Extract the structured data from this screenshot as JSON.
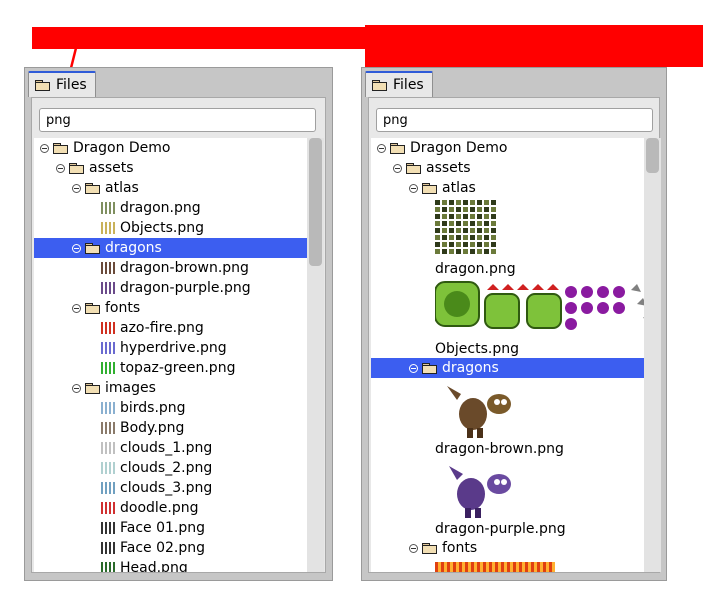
{
  "colors": {
    "accent": "#ff0000",
    "selection": "#3c5ef0"
  },
  "left_panel": {
    "tab_label": "Files",
    "search_value": "png",
    "tree": [
      {
        "label": "Dragon Demo",
        "kind": "folder",
        "icon": "folder-icon"
      },
      {
        "label": "assets",
        "kind": "folder",
        "icon": "folder-icon"
      },
      {
        "label": "atlas",
        "kind": "folder",
        "icon": "folder-icon"
      },
      {
        "label": "dragon.png",
        "kind": "file",
        "icon": "image-thumb-icon"
      },
      {
        "label": "Objects.png",
        "kind": "file",
        "icon": "image-thumb-icon"
      },
      {
        "label": "dragons",
        "kind": "folder",
        "icon": "folder-icon",
        "selected": true
      },
      {
        "label": "dragon-brown.png",
        "kind": "file",
        "icon": "image-thumb-icon"
      },
      {
        "label": "dragon-purple.png",
        "kind": "file",
        "icon": "image-thumb-icon"
      },
      {
        "label": "fonts",
        "kind": "folder",
        "icon": "folder-icon"
      },
      {
        "label": "azo-fire.png",
        "kind": "file",
        "icon": "image-thumb-icon"
      },
      {
        "label": "hyperdrive.png",
        "kind": "file",
        "icon": "image-thumb-icon"
      },
      {
        "label": "topaz-green.png",
        "kind": "file",
        "icon": "image-thumb-icon"
      },
      {
        "label": "images",
        "kind": "folder",
        "icon": "folder-icon"
      },
      {
        "label": "birds.png",
        "kind": "file",
        "icon": "image-thumb-icon"
      },
      {
        "label": "Body.png",
        "kind": "file",
        "icon": "image-thumb-icon"
      },
      {
        "label": "clouds_1.png",
        "kind": "file",
        "icon": "image-thumb-icon"
      },
      {
        "label": "clouds_2.png",
        "kind": "file",
        "icon": "image-thumb-icon"
      },
      {
        "label": "clouds_3.png",
        "kind": "file",
        "icon": "image-thumb-icon"
      },
      {
        "label": "doodle.png",
        "kind": "file",
        "icon": "image-thumb-icon"
      },
      {
        "label": "Face 01.png",
        "kind": "file",
        "icon": "image-thumb-icon"
      },
      {
        "label": "Face 02.png",
        "kind": "file",
        "icon": "image-thumb-icon"
      },
      {
        "label": "Head.png",
        "kind": "file",
        "icon": "image-thumb-icon"
      }
    ]
  },
  "right_panel": {
    "tab_label": "Files",
    "search_value": "png",
    "tree": [
      {
        "label": "Dragon Demo",
        "kind": "folder"
      },
      {
        "label": "assets",
        "kind": "folder"
      },
      {
        "label": "atlas",
        "kind": "folder"
      },
      {
        "label": "dragon.png",
        "kind": "image",
        "icon": "dragon-atlas-preview"
      },
      {
        "label": "Objects.png",
        "kind": "image",
        "icon": "objects-preview"
      },
      {
        "label": "dragons",
        "kind": "folder",
        "selected": true
      },
      {
        "label": "dragon-brown.png",
        "kind": "image",
        "icon": "brown-dragon-preview"
      },
      {
        "label": "dragon-purple.png",
        "kind": "image",
        "icon": "purple-dragon-preview"
      },
      {
        "label": "fonts",
        "kind": "folder"
      }
    ]
  }
}
